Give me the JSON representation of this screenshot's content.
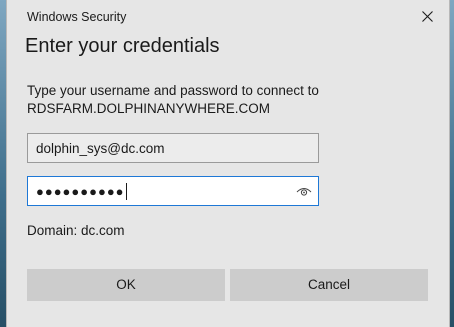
{
  "window": {
    "title": "Windows Security"
  },
  "dialog": {
    "heading": "Enter your credentials",
    "instruction_line1": "Type your username and password to connect to",
    "instruction_line2": "RDSFARM.DOLPHINANYWHERE.COM"
  },
  "form": {
    "username_value": "dolphin_sys@dc.com",
    "password_masked": "●●●●●●●●●●",
    "domain_label": "Domain: dc.com"
  },
  "buttons": {
    "ok_label": "OK",
    "cancel_label": "Cancel"
  },
  "icons": {
    "close": "close-icon",
    "reveal": "eye-icon"
  },
  "colors": {
    "dialog_bg": "#e6e6e6",
    "focus_border": "#1e78d6",
    "button_bg": "#cccccc"
  }
}
